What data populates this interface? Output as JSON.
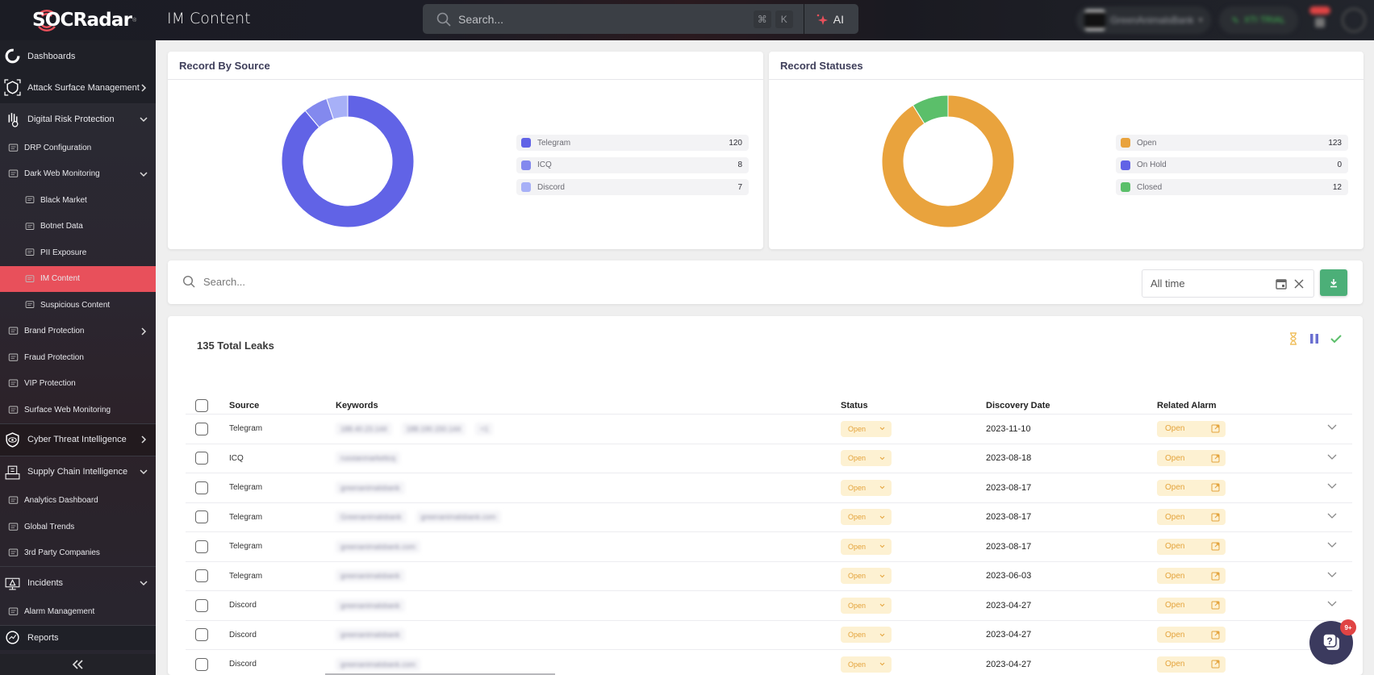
{
  "topbar": {
    "logo_text": "SOCRadar",
    "page_title": "IM Content",
    "search_placeholder": "Search...",
    "shortcut_keys": [
      "⌘",
      "K"
    ],
    "ai_label": "AI",
    "org_name": "GreenAnimalsBank",
    "trial_label": "XTI TRIAL"
  },
  "sidebar": {
    "items": [
      {
        "label": "Dashboards",
        "level": 0,
        "icon": "dashboard-icon"
      },
      {
        "label": "Attack Surface Management",
        "level": 0,
        "icon": "attack-surface-icon",
        "chevron": "right"
      },
      {
        "label": "Digital Risk Protection",
        "level": 0,
        "icon": "hand-icon",
        "chevron": "down"
      },
      {
        "label": "DRP Configuration",
        "level": 1,
        "icon": "laptop-icon"
      },
      {
        "label": "Dark Web Monitoring",
        "level": 1,
        "icon": "building-icon",
        "chevron": "down"
      },
      {
        "label": "Black Market",
        "level": 2,
        "icon": "black-market-icon"
      },
      {
        "label": "Botnet Data",
        "level": 2,
        "icon": "bug-icon"
      },
      {
        "label": "PII Exposure",
        "level": 2,
        "icon": "id-card-icon"
      },
      {
        "label": "IM Content",
        "level": 2,
        "icon": "message-icon",
        "active": true
      },
      {
        "label": "Suspicious Content",
        "level": 2,
        "icon": "suspicious-icon"
      },
      {
        "label": "Brand Protection",
        "level": 1,
        "icon": "brand-icon",
        "chevron": "right"
      },
      {
        "label": "Fraud Protection",
        "level": 1,
        "icon": "fraud-icon"
      },
      {
        "label": "VIP Protection",
        "level": 1,
        "icon": "vip-icon"
      },
      {
        "label": "Surface Web Monitoring",
        "level": 1,
        "icon": "surface-web-icon"
      },
      {
        "label": "Cyber Threat Intelligence",
        "level": 0,
        "icon": "eye-shield-icon",
        "chevron": "right"
      },
      {
        "label": "Supply Chain Intelligence",
        "level": 0,
        "icon": "supply-chain-icon",
        "chevron": "down"
      },
      {
        "label": "Analytics Dashboard",
        "level": 1,
        "icon": "analytics-icon"
      },
      {
        "label": "Global Trends",
        "level": 1,
        "icon": "trends-icon"
      },
      {
        "label": "3rd Party Companies",
        "level": 1,
        "icon": "companies-icon"
      },
      {
        "label": "Incidents",
        "level": 0,
        "icon": "alert-monitor-icon",
        "chevron": "down"
      },
      {
        "label": "Alarm Management",
        "level": 1,
        "icon": "alarm-icon"
      },
      {
        "label": "Reports",
        "level": 0,
        "icon": "reports-icon"
      }
    ],
    "collapse_label": "«"
  },
  "cards": {
    "source": {
      "title": "Record By Source",
      "legend": [
        {
          "label": "Telegram",
          "value": "120",
          "color": "#6163e6"
        },
        {
          "label": "ICQ",
          "value": "8",
          "color": "#8389ee"
        },
        {
          "label": "Discord",
          "value": "7",
          "color": "#a7b0f7"
        }
      ]
    },
    "status": {
      "title": "Record Statuses",
      "legend": [
        {
          "label": "Open",
          "value": "123",
          "color": "#e9a33d"
        },
        {
          "label": "On Hold",
          "value": "0",
          "color": "#6163e6"
        },
        {
          "label": "Closed",
          "value": "12",
          "color": "#5bbf6a"
        }
      ]
    }
  },
  "chart_data": [
    {
      "type": "pie",
      "title": "Record By Source",
      "categories": [
        "Telegram",
        "ICQ",
        "Discord"
      ],
      "values": [
        120,
        8,
        7
      ],
      "colors": [
        "#6163e6",
        "#8389ee",
        "#a7b0f7"
      ],
      "legend": "right"
    },
    {
      "type": "pie",
      "title": "Record Statuses",
      "categories": [
        "Open",
        "On Hold",
        "Closed"
      ],
      "values": [
        123,
        0,
        12
      ],
      "colors": [
        "#e9a33d",
        "#6163e6",
        "#5bbf6a"
      ],
      "legend": "right"
    }
  ],
  "filter": {
    "search_placeholder": "Search...",
    "date_range": "All time"
  },
  "table": {
    "total_label": "135 Total Leaks",
    "columns": [
      "Source",
      "Keywords",
      "Status",
      "Discovery Date",
      "Related Alarm"
    ],
    "rows": [
      {
        "source": "Telegram",
        "keywords": [
          "188.40.23.144",
          "188.190.150.144",
          "+1"
        ],
        "status": "Open",
        "date": "2023-11-10",
        "alarm": "Open"
      },
      {
        "source": "ICQ",
        "keywords": [
          "russianmarketicq"
        ],
        "status": "Open",
        "date": "2023-08-18",
        "alarm": "Open"
      },
      {
        "source": "Telegram",
        "keywords": [
          "greenanimalsbank"
        ],
        "status": "Open",
        "date": "2023-08-17",
        "alarm": "Open"
      },
      {
        "source": "Telegram",
        "keywords": [
          "Greenanimalsbank",
          "greenanimalsbank.com"
        ],
        "status": "Open",
        "date": "2023-08-17",
        "alarm": "Open"
      },
      {
        "source": "Telegram",
        "keywords": [
          "greenanimalsbank.com"
        ],
        "status": "Open",
        "date": "2023-08-17",
        "alarm": "Open"
      },
      {
        "source": "Telegram",
        "keywords": [
          "greenanimalsbank"
        ],
        "status": "Open",
        "date": "2023-06-03",
        "alarm": "Open"
      },
      {
        "source": "Discord",
        "keywords": [
          "greenanimalsbank"
        ],
        "status": "Open",
        "date": "2023-04-27",
        "alarm": "Open"
      },
      {
        "source": "Discord",
        "keywords": [
          "greenanimalsbank"
        ],
        "status": "Open",
        "date": "2023-04-27",
        "alarm": "Open"
      },
      {
        "source": "Discord",
        "keywords": [
          "greenanimalsbank.com"
        ],
        "status": "Open",
        "date": "2023-04-27",
        "alarm": "Open"
      }
    ]
  },
  "help": {
    "badge": "9+"
  }
}
